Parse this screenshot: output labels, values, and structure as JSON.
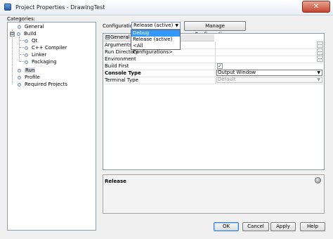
{
  "window": {
    "title": "Project Properties - DrawingTest",
    "close_glyph": "✕"
  },
  "categories": {
    "label": "Categories:",
    "items": [
      {
        "label": "General",
        "expander": ""
      },
      {
        "label": "Build",
        "expander": "⊟"
      },
      {
        "label": "Qt"
      },
      {
        "label": "C++ Compiler"
      },
      {
        "label": "Linker"
      },
      {
        "label": "Packaging"
      },
      {
        "label": "Run",
        "selected": true
      },
      {
        "label": "Profile"
      },
      {
        "label": "Required Projects"
      }
    ]
  },
  "configuration": {
    "label": "Configuration:",
    "value": "Release (active)",
    "options": [
      "Debug",
      "Release (active)",
      "<All Configurations>"
    ],
    "highlighted": "Debug",
    "manage_label": "Manage Configurations..."
  },
  "properties": {
    "section": "General",
    "section_toggle": "⊟",
    "rows": [
      {
        "name": "Arguments",
        "value": "",
        "ellipsis": "..."
      },
      {
        "name": "Run Directory",
        "value": "",
        "ellipsis": "..."
      },
      {
        "name": "Environment",
        "value": "",
        "ellipsis": "..."
      },
      {
        "name": "Build First",
        "checked": true,
        "check_glyph": "✓"
      },
      {
        "name": "Console Type",
        "value": "Output Window"
      },
      {
        "name": "Terminal Type",
        "value": "Default"
      }
    ]
  },
  "description": {
    "title": "Release"
  },
  "buttons": {
    "ok": "OK",
    "cancel": "Cancel",
    "apply": "Apply",
    "help": "Help"
  },
  "icons": {
    "dropdown_arrow": "▼"
  }
}
